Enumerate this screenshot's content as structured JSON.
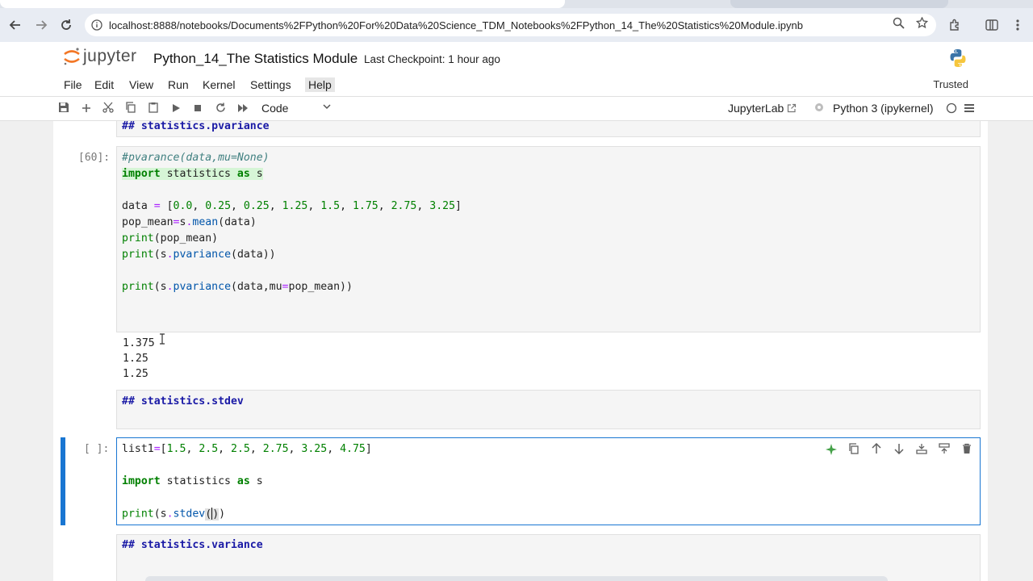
{
  "browser": {
    "url": "localhost:8888/notebooks/Documents%2FPython%20For%20Data%20Science_TDM_Notebooks%2FPython_14_The%20Statistics%20Module.ipynb",
    "back_icon": "arrow-left-icon",
    "forward_icon": "arrow-right-icon",
    "reload_icon": "reload-icon"
  },
  "header": {
    "logo_text": "jupyter",
    "notebook_title": "Python_14_The Statistics Module",
    "checkpoint": "Last Checkpoint: 1 hour ago"
  },
  "menubar": {
    "items": [
      "File",
      "Edit",
      "View",
      "Run",
      "Kernel",
      "Settings",
      "Help"
    ],
    "trusted": "Trusted"
  },
  "toolbar": {
    "cell_type": "Code",
    "jupyterlab_label": "JupyterLab",
    "kernel_label": "Python 3 (ipykernel)"
  },
  "cells": {
    "md_pvariance": "## statistics.pvariance",
    "cell60": {
      "prompt": "[60]:",
      "lines": [
        "#pvarance(data,mu=None)",
        "import statistics as s",
        "",
        "data = [0.0, 0.25, 0.25, 1.25, 1.5, 1.75, 2.75, 3.25]",
        "pop_mean=s.mean(data)",
        "print(pop_mean)",
        "print(s.pvariance(data))",
        "",
        "print(s.pvariance(data,mu=pop_mean))"
      ],
      "outputs": [
        "1.375",
        "1.25",
        "1.25"
      ]
    },
    "md_stdev": "## statistics.stdev",
    "active": {
      "prompt": "[ ]:",
      "lines": [
        "list1=[1.5, 2.5, 2.5, 2.75, 3.25, 4.75]",
        "",
        "import statistics as s",
        "",
        "print(s.stdev())"
      ]
    },
    "md_variance": "## statistics.variance"
  }
}
